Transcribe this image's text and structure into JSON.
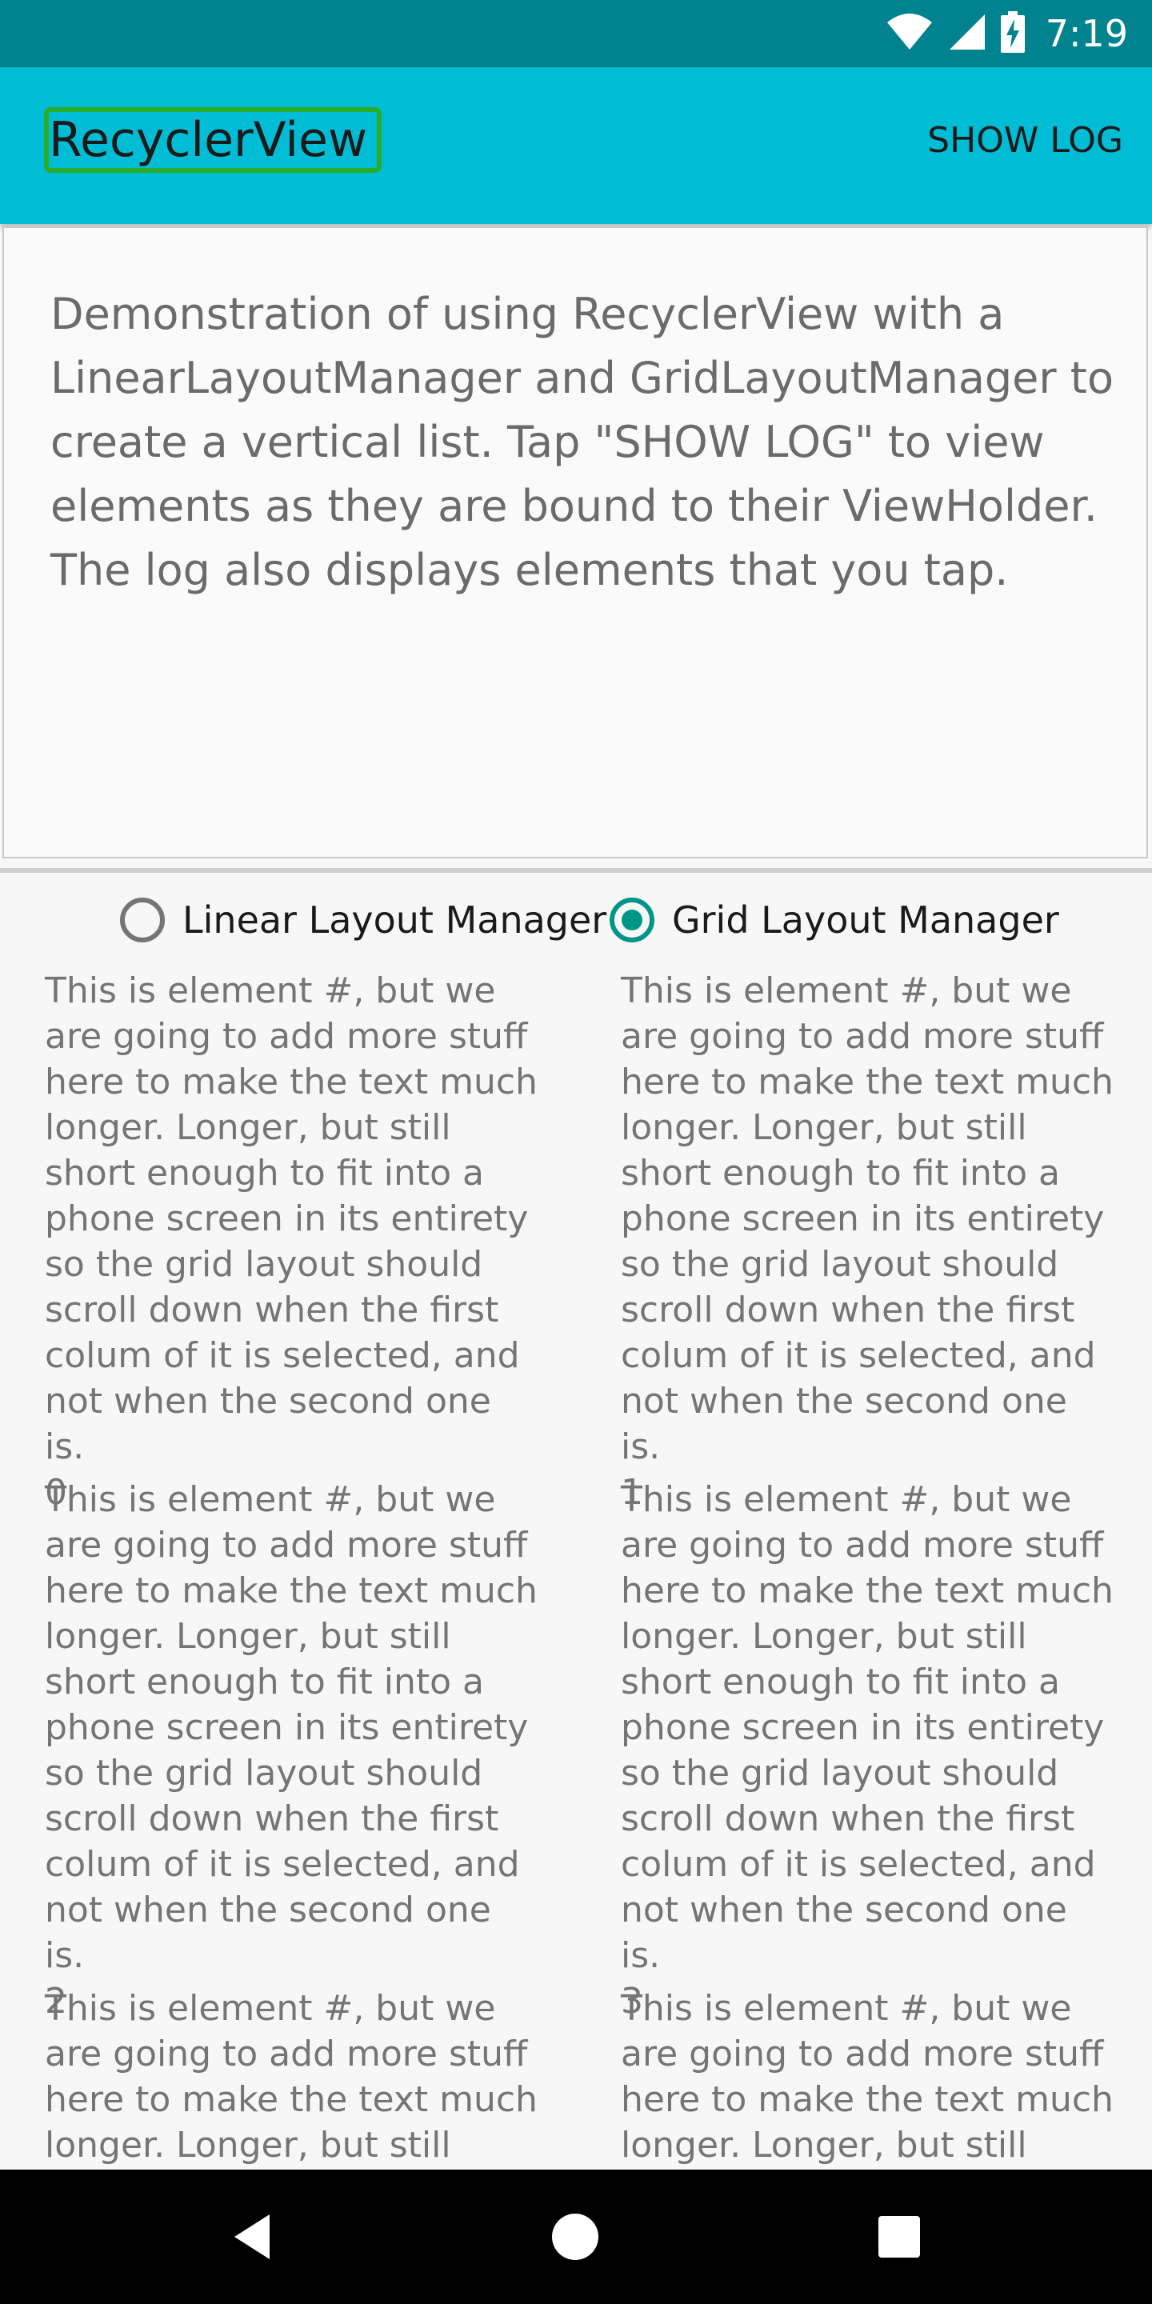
{
  "status_bar": {
    "time": "7:19",
    "icons": [
      "wifi-icon",
      "signal-icon",
      "battery-charging-icon"
    ]
  },
  "app_bar": {
    "title": "RecyclerView",
    "action_label": "SHOW LOG"
  },
  "description": "Demonstration of using RecyclerView with a LinearLayoutManager and GridLayoutManager to create a vertical list. Tap \"SHOW LOG\" to view elements as they are bound to their ViewHolder. The log also displays elements that you tap.",
  "layout_options": [
    {
      "label": "Linear Layout Manager",
      "selected": false
    },
    {
      "label": "Grid Layout Manager",
      "selected": true
    }
  ],
  "grid_items": [
    {
      "text": "This is element #, but we are going to add more stuff here to make the text much longer. Longer, but still short enough to fit into a phone screen in its entirety so the grid layout should scroll down when the first colum of it is selected, and not when the second one is.",
      "number": "0"
    },
    {
      "text": "This is element #, but we are going to add more stuff here to make the text much longer. Longer, but still short enough to fit into a phone screen in its entirety so the grid layout should scroll down when the first colum of it is selected, and not when the second one is.",
      "number": "1"
    },
    {
      "text": "This is element #, but we are going to add more stuff here to make the text much longer. Longer, but still short enough to fit into a phone screen in its entirety so the grid layout should scroll down when the first colum of it is selected, and not when the second one is.",
      "number": "2"
    },
    {
      "text": "This is element #, but we are going to add more stuff here to make the text much longer. Longer, but still short enough to fit into a phone screen in its entirety so the grid layout should scroll down when the first colum of it is selected, and not when the second one is.",
      "number": "3"
    },
    {
      "text": "This is element #, but we are going to add more stuff here to make the text much longer. Longer, but still",
      "number": ""
    },
    {
      "text": "This is element #, but we are going to add more stuff here to make the text much longer. Longer, but still",
      "number": ""
    }
  ],
  "nav_bar": {
    "buttons": [
      "back-icon",
      "home-icon",
      "recents-icon"
    ]
  },
  "colors": {
    "status_bar": "#00838f",
    "app_bar": "#00bcd4",
    "radio_accent": "#009688",
    "selection_highlight": "#2aad2a"
  }
}
